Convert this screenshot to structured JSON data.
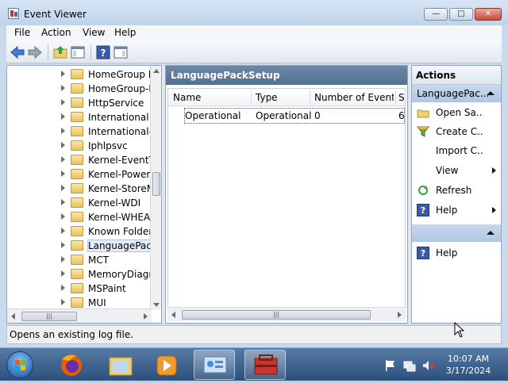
{
  "window": {
    "title": "Event Viewer",
    "app_icon": "event-viewer-icon"
  },
  "caption_buttons": {
    "minimize": "—",
    "maximize": "□",
    "close": "✕"
  },
  "menu": [
    "File",
    "Action",
    "View",
    "Help"
  ],
  "toolbar": {
    "icons": [
      "back-arrow-icon",
      "forward-arrow-icon",
      "up-folder-icon",
      "show-hide-console-tree-icon",
      "help-icon",
      "show-hide-action-pane-icon"
    ]
  },
  "tree": {
    "items": [
      "HomeGroup P",
      "HomeGroup-L",
      "HttpService",
      "International",
      "International-R",
      "Iphlpsvc",
      "Kernel-EventTr",
      "Kernel-Power",
      "Kernel-StoreM",
      "Kernel-WDI",
      "Kernel-WHEA",
      "Known Folders",
      "LanguagePack",
      "MCT",
      "MemoryDiagn",
      "MSPaint",
      "MUI"
    ],
    "selected_index": 12
  },
  "center": {
    "header": "LanguagePackSetup",
    "columns": [
      "Name",
      "Type",
      "Number of Events",
      "S"
    ],
    "rows": [
      {
        "name": "Operational",
        "type": "Operational",
        "events": "0",
        "size": "6"
      }
    ]
  },
  "actions": {
    "header": "Actions",
    "section1": "LanguagePac...",
    "items1": [
      {
        "label": "Open Sa...",
        "icon": "open-folder-icon"
      },
      {
        "label": "Create C...",
        "icon": "filter-funnel-icon"
      },
      {
        "label": "Import C...",
        "icon": ""
      },
      {
        "label": "View",
        "icon": "",
        "submenu": true
      },
      {
        "label": "Refresh",
        "icon": "refresh-icon"
      },
      {
        "label": "Help",
        "icon": "help-icon",
        "submenu": true
      }
    ],
    "section2": "",
    "items2": [
      {
        "label": "Help",
        "icon": "help-icon"
      }
    ]
  },
  "status": "Opens an existing log file.",
  "taskbar": {
    "apps": [
      "firefox-icon",
      "file-explorer-icon",
      "media-player-icon",
      "network-control-panel-icon",
      "event-viewer-toolbox-icon"
    ],
    "active_index": 4,
    "tray_icons": [
      "flag-icon",
      "network-icon",
      "volume-muted-icon"
    ],
    "time": "10:07 AM",
    "date": "3/17/2024"
  }
}
